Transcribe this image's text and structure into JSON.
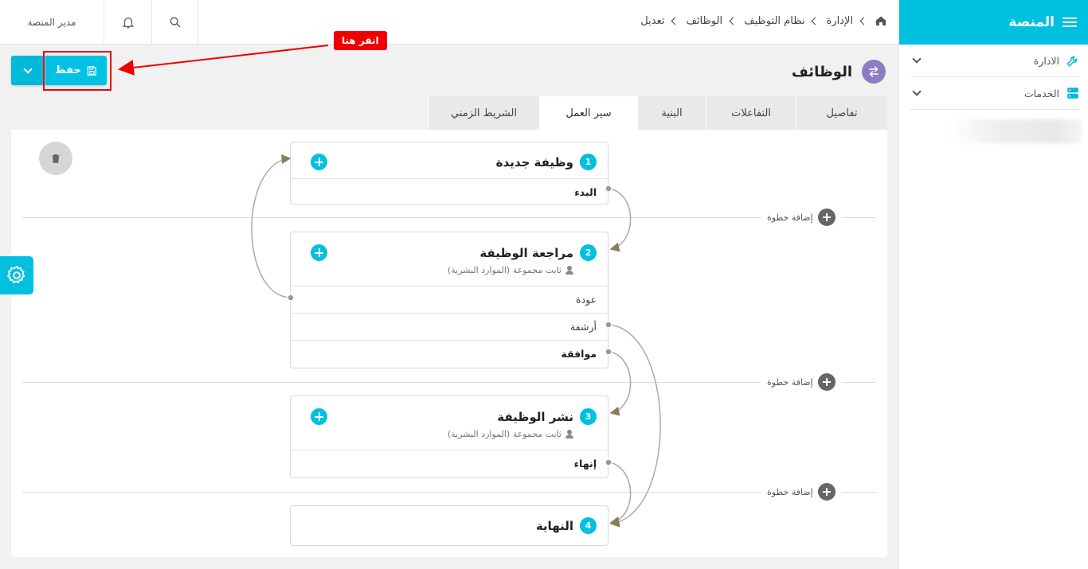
{
  "sidebar": {
    "title": "المنصة",
    "items": [
      {
        "label": "الادارة"
      },
      {
        "label": "الخدمات"
      }
    ]
  },
  "topbar": {
    "user": "مدير المنصة",
    "breadcrumb": [
      "الإدارة",
      "نظام التوظيف",
      "الوظائف",
      "تعديل"
    ]
  },
  "toolbar": {
    "save_label": "حفظ"
  },
  "annotation": {
    "click_here": "انقر هنا"
  },
  "page": {
    "title": "الوظائف"
  },
  "tabs": [
    "تفاصيل",
    "التفاعلات",
    "البنية",
    "سير العمل",
    "الشريط الزمني"
  ],
  "active_tab": "سير العمل",
  "add_step_label": "إضافة خطوة",
  "steps": [
    {
      "number": "1",
      "title": "وظيفة جديدة",
      "subtitle": "",
      "actions": [
        {
          "label": "البدء",
          "bold": true
        }
      ]
    },
    {
      "number": "2",
      "title": "مراجعة الوظيفة",
      "subtitle": "ثابت مجموعة (الموارد البشرية)",
      "actions": [
        {
          "label": "عودة",
          "bold": false
        },
        {
          "label": "أرشفة",
          "bold": false
        },
        {
          "label": "موافقة",
          "bold": true
        }
      ]
    },
    {
      "number": "3",
      "title": "نشر الوظيفة",
      "subtitle": "ثابت مجموعة (الموارد البشرية)",
      "actions": [
        {
          "label": "إنهاء",
          "bold": true
        }
      ]
    },
    {
      "number": "4",
      "title": "النهاية",
      "subtitle": "",
      "actions": []
    }
  ],
  "colors": {
    "accent": "#00c0e0",
    "title_icon": "#8e7cc3",
    "annotation": "#e00000"
  }
}
